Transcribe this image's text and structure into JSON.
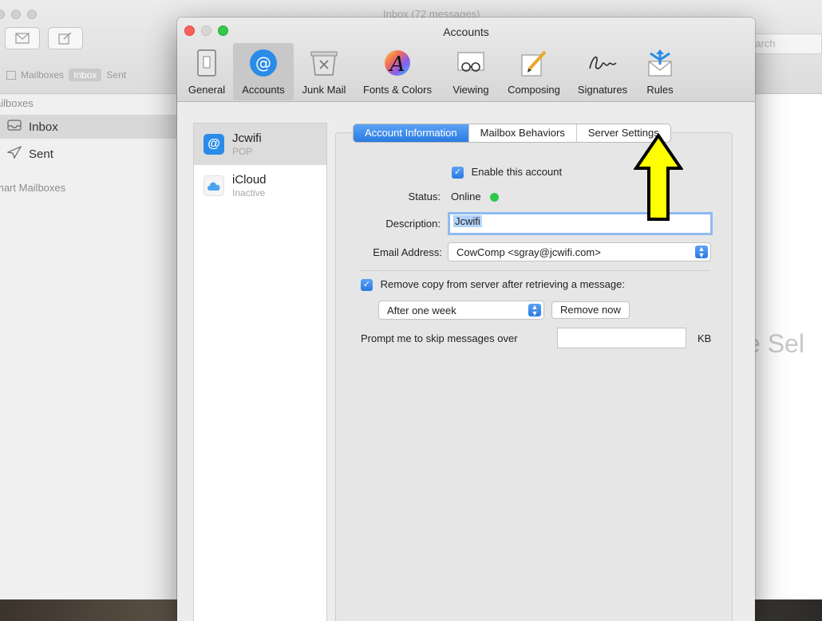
{
  "mail": {
    "window_title": "Inbox (72 messages)",
    "favorites": [
      "Mailboxes",
      "Inbox",
      "Sent"
    ],
    "search_placeholder": "Search",
    "search_visible": "earch",
    "sidebar": {
      "section_mailboxes": "Mailboxes",
      "section_mailboxes_visible": "ailboxes",
      "items": [
        {
          "label": "Inbox",
          "icon": "inbox-icon",
          "selected": true
        },
        {
          "label": "Sent",
          "icon": "sent-icon",
          "selected": false
        }
      ],
      "section_smart": "Smart Mailboxes",
      "section_smart_visible": "mart Mailboxes"
    },
    "no_selection_visible": "e Sel"
  },
  "prefs": {
    "title": "Accounts",
    "toolbar": [
      {
        "label": "General",
        "icon": "general-icon"
      },
      {
        "label": "Accounts",
        "icon": "accounts-icon",
        "selected": true
      },
      {
        "label": "Junk Mail",
        "icon": "junk-mail-icon"
      },
      {
        "label": "Fonts & Colors",
        "icon": "fonts-colors-icon"
      },
      {
        "label": "Viewing",
        "icon": "viewing-icon"
      },
      {
        "label": "Composing",
        "icon": "composing-icon"
      },
      {
        "label": "Signatures",
        "icon": "signatures-icon"
      },
      {
        "label": "Rules",
        "icon": "rules-icon"
      }
    ],
    "accounts": [
      {
        "name": "Jcwifi",
        "type": "POP",
        "icon": "at-icon",
        "selected": true
      },
      {
        "name": "iCloud",
        "type": "Inactive",
        "icon": "icloud-icon",
        "selected": false
      }
    ],
    "tabs": [
      {
        "label": "Account Information",
        "active": true
      },
      {
        "label": "Mailbox Behaviors",
        "active": false
      },
      {
        "label": "Server Settings",
        "active": false
      }
    ],
    "form": {
      "enable_label": "Enable this account",
      "enable_checked": true,
      "status_label": "Status:",
      "status_value": "Online",
      "status_color": "#2fc84a",
      "description_label": "Description:",
      "description_value": "Jcwifi",
      "email_label": "Email Address:",
      "email_value": "CowComp <sgray@jcwifi.com>",
      "remove_copy_label": "Remove copy from server after retrieving a message:",
      "remove_copy_checked": true,
      "remove_after_value": "After one week",
      "remove_now_label": "Remove now",
      "prompt_label": "Prompt me to skip messages over",
      "prompt_value": "",
      "prompt_unit": "KB"
    },
    "annotation": {
      "shape": "up-arrow",
      "color": "#ffff00",
      "points_to": "Server Settings"
    },
    "accent": "#2a7ae2"
  }
}
